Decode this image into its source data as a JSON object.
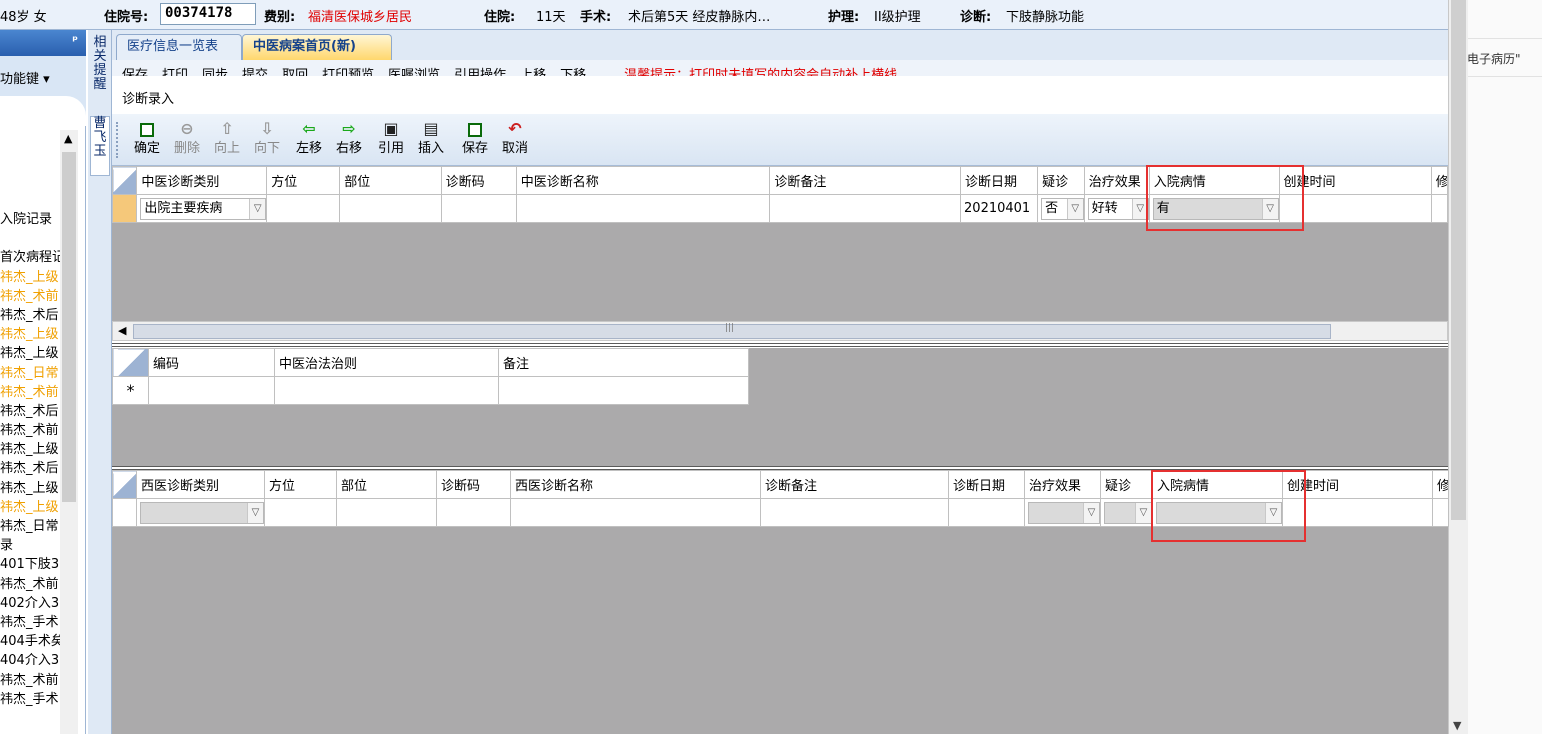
{
  "header": {
    "age_sex": "48岁 女",
    "admission_label": "住院号:",
    "admission_no": "00374178",
    "fee_label": "费别:",
    "fee_value": "福清医保城乡居民",
    "stay_label": "住院:",
    "stay_value": "11天",
    "surgery_label": "手术:",
    "surgery_value": "术后第5天  经皮静脉内…",
    "nursing_label": "护理:",
    "nursing_value": "II级护理",
    "diag_label": "诊断:",
    "diag_value": "下肢静脉功能"
  },
  "outer_right": {
    "text": "电子病历\""
  },
  "left_panel": {
    "pin": "ᵖ",
    "func_key": "功能键 ▾",
    "items": [
      {
        "text": "入院记录",
        "color": "black"
      },
      {
        "text": "",
        "color": "black"
      },
      {
        "text": "首次病程记",
        "color": "black"
      },
      {
        "text": "祎杰_上级",
        "color": "orange"
      },
      {
        "text": "祎杰_术前",
        "color": "orange"
      },
      {
        "text": "祎杰_术后",
        "color": "black"
      },
      {
        "text": "祎杰_上级",
        "color": "orange"
      },
      {
        "text": "祎杰_上级",
        "color": "black"
      },
      {
        "text": "祎杰_日常",
        "color": "orange"
      },
      {
        "text": "祎杰_术前",
        "color": "orange"
      },
      {
        "text": "祎杰_术后",
        "color": "black"
      },
      {
        "text": "祎杰_术前",
        "color": "black"
      },
      {
        "text": "祎杰_上级",
        "color": "black"
      },
      {
        "text": "祎杰_术后",
        "color": "black"
      },
      {
        "text": "祎杰_上级",
        "color": "black"
      },
      {
        "text": "祎杰_上级",
        "color": "orange"
      },
      {
        "text": "祎杰_日常",
        "color": "black"
      },
      {
        "text": "录",
        "color": "black"
      },
      {
        "text": "401下肢3",
        "color": "black"
      },
      {
        "text": "祎杰_术前",
        "color": "black"
      },
      {
        "text": "402介入3",
        "color": "black"
      },
      {
        "text": "祎杰_手术",
        "color": "black"
      },
      {
        "text": "404手术矣",
        "color": "black"
      },
      {
        "text": "404介入3",
        "color": "black"
      },
      {
        "text": "祎杰_术前",
        "color": "black"
      },
      {
        "text": "祎杰_手术",
        "color": "black"
      }
    ]
  },
  "vertical_tabs": {
    "related_reminder": "相关提醒",
    "user": "曹飞玉"
  },
  "tabs": [
    {
      "label": "医疗信息一览表"
    },
    {
      "label": "中医病案首页(新)"
    }
  ],
  "outer_toolbar": {
    "items": [
      "保存",
      "打印",
      "同步",
      "提交",
      "取回",
      "打印预览",
      "医嘱浏览",
      "引用操作",
      "上移",
      "下移"
    ],
    "reminder": "温馨提示：打印时未填写的内容会自动补上横线"
  },
  "dialog": {
    "title": "诊断录入",
    "toolbar": [
      {
        "label": "确定",
        "icon": "save-icon",
        "enabled": true
      },
      {
        "label": "删除",
        "icon": "delete-icon",
        "enabled": false
      },
      {
        "label": "向上",
        "icon": "arrow-up-icon",
        "enabled": false
      },
      {
        "label": "向下",
        "icon": "arrow-down-icon",
        "enabled": false
      },
      {
        "label": "左移",
        "icon": "arrow-left-icon",
        "enabled": true
      },
      {
        "label": "右移",
        "icon": "arrow-right-icon",
        "enabled": true
      },
      {
        "label": "引用",
        "icon": "quote-icon",
        "enabled": true
      },
      {
        "label": "插入",
        "icon": "insert-icon",
        "enabled": true
      },
      {
        "label": "保存",
        "icon": "save-icon",
        "enabled": true
      },
      {
        "label": "取消",
        "icon": "undo-icon",
        "enabled": true
      }
    ]
  },
  "tcm_grid": {
    "columns": [
      "中医诊断类别",
      "方位",
      "部位",
      "诊断码",
      "中医诊断名称",
      "诊断备注",
      "诊断日期",
      "疑诊",
      "治疗效果",
      "入院病情",
      "创建时间",
      "修"
    ],
    "row": {
      "category": "出院主要疾病",
      "direction": "",
      "site": "",
      "code": "",
      "name": "",
      "note": "",
      "date": "20210401",
      "suspected": "否",
      "effect": "好转",
      "admission_condition": "有",
      "created": ""
    }
  },
  "treatment_grid": {
    "columns": [
      "编码",
      "中医治法治则",
      "备注"
    ],
    "new_row_marker": "*"
  },
  "western_grid": {
    "columns": [
      "西医诊断类别",
      "方位",
      "部位",
      "诊断码",
      "西医诊断名称",
      "诊断备注",
      "诊断日期",
      "治疗效果",
      "疑诊",
      "入院病情",
      "创建时间",
      "修"
    ]
  },
  "colors": {
    "highlight_border": "#e53030",
    "grid_background": "#abaaab",
    "selected_row_header": "#f5c87a",
    "active_tab": "#ffd76d",
    "warning_text": "#e00000"
  }
}
